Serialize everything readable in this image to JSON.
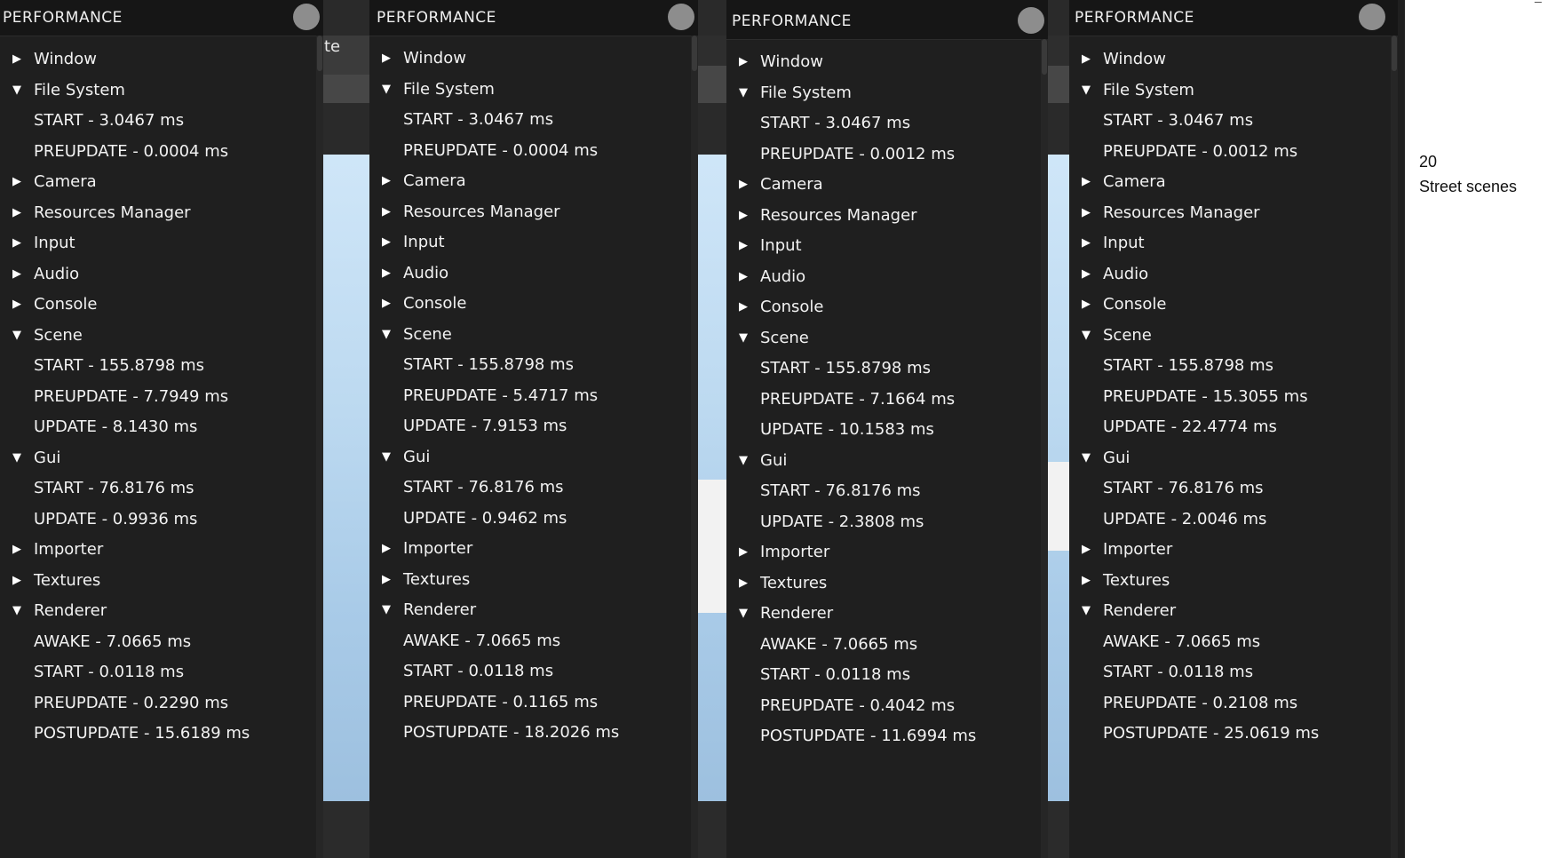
{
  "background_label": "ite",
  "note": {
    "line1": "20",
    "line2": "Street scenes"
  },
  "panels": [
    {
      "title": "PERFORMANCE",
      "rows": [
        {
          "kind": "node",
          "arrow": "▶",
          "text": "Window"
        },
        {
          "kind": "node",
          "arrow": "▼",
          "text": "File System"
        },
        {
          "kind": "start",
          "text": "START - 3.0467 ms"
        },
        {
          "kind": "green",
          "text": "PREUPDATE - 0.0004 ms"
        },
        {
          "kind": "node",
          "arrow": "▶",
          "text": "Camera"
        },
        {
          "kind": "node",
          "arrow": "▶",
          "text": "Resources Manager"
        },
        {
          "kind": "node",
          "arrow": "▶",
          "text": "Input"
        },
        {
          "kind": "node",
          "arrow": "▶",
          "text": "Audio"
        },
        {
          "kind": "node",
          "arrow": "▶",
          "text": "Console"
        },
        {
          "kind": "node",
          "arrow": "▼",
          "text": "Scene"
        },
        {
          "kind": "start",
          "text": "START - 155.8798 ms"
        },
        {
          "kind": "green",
          "text": "PREUPDATE - 7.7949 ms"
        },
        {
          "kind": "green",
          "text": "UPDATE - 8.1430 ms"
        },
        {
          "kind": "node",
          "arrow": "▼",
          "text": "Gui"
        },
        {
          "kind": "start",
          "text": "START - 76.8176 ms"
        },
        {
          "kind": "green",
          "text": "UPDATE - 0.9936 ms"
        },
        {
          "kind": "node",
          "arrow": "▶",
          "text": "Importer"
        },
        {
          "kind": "node",
          "arrow": "▶",
          "text": "Textures"
        },
        {
          "kind": "node",
          "arrow": "▼",
          "text": "Renderer"
        },
        {
          "kind": "awake",
          "text": "AWAKE - 7.0665 ms"
        },
        {
          "kind": "start",
          "text": "START - 0.0118 ms"
        },
        {
          "kind": "green",
          "text": "PREUPDATE - 0.2290 ms"
        },
        {
          "kind": "green",
          "text": "POSTUPDATE - 15.6189 ms"
        }
      ]
    },
    {
      "title": "PERFORMANCE",
      "rows": [
        {
          "kind": "node",
          "arrow": "▶",
          "text": "Window"
        },
        {
          "kind": "node",
          "arrow": "▼",
          "text": "File System"
        },
        {
          "kind": "start",
          "text": "START - 3.0467 ms"
        },
        {
          "kind": "green",
          "text": "PREUPDATE - 0.0004 ms"
        },
        {
          "kind": "node",
          "arrow": "▶",
          "text": "Camera"
        },
        {
          "kind": "node",
          "arrow": "▶",
          "text": "Resources Manager"
        },
        {
          "kind": "node",
          "arrow": "▶",
          "text": "Input"
        },
        {
          "kind": "node",
          "arrow": "▶",
          "text": "Audio"
        },
        {
          "kind": "node",
          "arrow": "▶",
          "text": "Console"
        },
        {
          "kind": "node",
          "arrow": "▼",
          "text": "Scene"
        },
        {
          "kind": "start",
          "text": "START - 155.8798 ms"
        },
        {
          "kind": "green",
          "text": "PREUPDATE - 5.4717 ms"
        },
        {
          "kind": "green",
          "text": "UPDATE - 7.9153 ms"
        },
        {
          "kind": "node",
          "arrow": "▼",
          "text": "Gui"
        },
        {
          "kind": "start",
          "text": "START - 76.8176 ms"
        },
        {
          "kind": "green",
          "text": "UPDATE - 0.9462 ms"
        },
        {
          "kind": "node",
          "arrow": "▶",
          "text": "Importer"
        },
        {
          "kind": "node",
          "arrow": "▶",
          "text": "Textures"
        },
        {
          "kind": "node",
          "arrow": "▼",
          "text": "Renderer"
        },
        {
          "kind": "awake",
          "text": "AWAKE - 7.0665 ms"
        },
        {
          "kind": "start",
          "text": "START - 0.0118 ms"
        },
        {
          "kind": "green",
          "text": "PREUPDATE - 0.1165 ms"
        },
        {
          "kind": "green",
          "text": "POSTUPDATE - 18.2026 ms"
        }
      ]
    },
    {
      "title": "PERFORMANCE",
      "rows": [
        {
          "kind": "node",
          "arrow": "▶",
          "text": "Window"
        },
        {
          "kind": "node",
          "arrow": "▼",
          "text": "File System"
        },
        {
          "kind": "start",
          "text": "START - 3.0467 ms"
        },
        {
          "kind": "green",
          "text": "PREUPDATE - 0.0012 ms"
        },
        {
          "kind": "node",
          "arrow": "▶",
          "text": "Camera"
        },
        {
          "kind": "node",
          "arrow": "▶",
          "text": "Resources Manager"
        },
        {
          "kind": "node",
          "arrow": "▶",
          "text": "Input"
        },
        {
          "kind": "node",
          "arrow": "▶",
          "text": "Audio"
        },
        {
          "kind": "node",
          "arrow": "▶",
          "text": "Console"
        },
        {
          "kind": "node",
          "arrow": "▼",
          "text": "Scene"
        },
        {
          "kind": "start",
          "text": "START - 155.8798 ms"
        },
        {
          "kind": "green",
          "text": "PREUPDATE - 7.1664 ms"
        },
        {
          "kind": "green",
          "text": "UPDATE - 10.1583 ms"
        },
        {
          "kind": "node",
          "arrow": "▼",
          "text": "Gui"
        },
        {
          "kind": "start",
          "text": "START - 76.8176 ms"
        },
        {
          "kind": "green",
          "text": "UPDATE - 2.3808 ms"
        },
        {
          "kind": "node",
          "arrow": "▶",
          "text": "Importer"
        },
        {
          "kind": "node",
          "arrow": "▶",
          "text": "Textures"
        },
        {
          "kind": "node",
          "arrow": "▼",
          "text": "Renderer"
        },
        {
          "kind": "awake",
          "text": "AWAKE - 7.0665 ms"
        },
        {
          "kind": "start",
          "text": "START - 0.0118 ms"
        },
        {
          "kind": "green",
          "text": "PREUPDATE - 0.4042 ms"
        },
        {
          "kind": "green",
          "text": "POSTUPDATE - 11.6994 ms"
        }
      ]
    },
    {
      "title": "PERFORMANCE",
      "rows": [
        {
          "kind": "node",
          "arrow": "▶",
          "text": "Window"
        },
        {
          "kind": "node",
          "arrow": "▼",
          "text": "File System"
        },
        {
          "kind": "start",
          "text": "START - 3.0467 ms"
        },
        {
          "kind": "green",
          "text": "PREUPDATE - 0.0012 ms"
        },
        {
          "kind": "node",
          "arrow": "▶",
          "text": "Camera"
        },
        {
          "kind": "node",
          "arrow": "▶",
          "text": "Resources Manager"
        },
        {
          "kind": "node",
          "arrow": "▶",
          "text": "Input"
        },
        {
          "kind": "node",
          "arrow": "▶",
          "text": "Audio"
        },
        {
          "kind": "node",
          "arrow": "▶",
          "text": "Console"
        },
        {
          "kind": "node",
          "arrow": "▼",
          "text": "Scene"
        },
        {
          "kind": "start",
          "text": "START - 155.8798 ms"
        },
        {
          "kind": "green",
          "text": "PREUPDATE - 15.3055 ms"
        },
        {
          "kind": "green",
          "text": "UPDATE - 22.4774 ms"
        },
        {
          "kind": "node",
          "arrow": "▼",
          "text": "Gui"
        },
        {
          "kind": "start",
          "text": "START - 76.8176 ms"
        },
        {
          "kind": "green",
          "text": "UPDATE - 2.0046 ms"
        },
        {
          "kind": "node",
          "arrow": "▶",
          "text": "Importer"
        },
        {
          "kind": "node",
          "arrow": "▶",
          "text": "Textures"
        },
        {
          "kind": "node",
          "arrow": "▼",
          "text": "Renderer"
        },
        {
          "kind": "awake",
          "text": "AWAKE - 7.0665 ms"
        },
        {
          "kind": "start",
          "text": "START - 0.0118 ms"
        },
        {
          "kind": "green",
          "text": "PREUPDATE - 0.2108 ms"
        },
        {
          "kind": "green",
          "text": "POSTUPDATE - 25.0619 ms"
        }
      ]
    }
  ],
  "colors": {
    "start": "#3cd6e4",
    "update": "#5ee51d",
    "awake": "#e8b41c",
    "panel_bg": "#1f1f1f",
    "close_button": "#8d8d8d"
  }
}
